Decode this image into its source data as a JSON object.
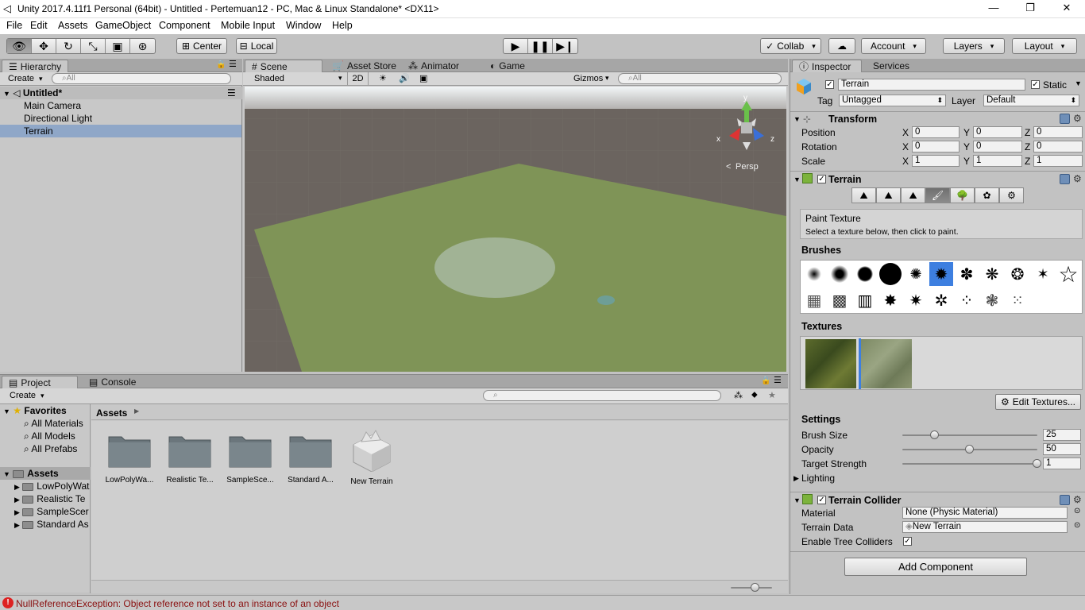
{
  "window": {
    "title": "Unity 2017.4.11f1 Personal (64bit) - Untitled - Pertemuan12 - PC, Mac & Linux Standalone* <DX11>",
    "minimize": "—",
    "maximize": "❐",
    "close": "✕"
  },
  "menu": [
    "File",
    "Edit",
    "Assets",
    "GameObject",
    "Component",
    "Mobile Input",
    "Window",
    "Help"
  ],
  "toolbar": {
    "pivot_center": "Center",
    "pivot_local": "Local",
    "collab": "Collab",
    "account": "Account",
    "layers": "Layers",
    "layout": "Layout"
  },
  "hierarchy": {
    "tab": "Hierarchy",
    "create": "Create",
    "search_placeholder": "All",
    "scene": "Untitled*",
    "items": [
      "Main Camera",
      "Directional Light",
      "Terrain"
    ],
    "selected": "Terrain"
  },
  "scene_view": {
    "tabs": [
      "Scene",
      "Asset Store",
      "Animator",
      "Game"
    ],
    "shading": "Shaded",
    "mode_2d": "2D",
    "gizmos": "Gizmos",
    "search_placeholder": "All",
    "gizmo_y": "y",
    "gizmo_x": "x",
    "gizmo_z": "z",
    "persp": "Persp",
    "colors": {
      "sky": "#e8eef0",
      "ground": "#6b645f",
      "terrain": "#7f9457"
    }
  },
  "project": {
    "tabs": [
      "Project",
      "Console"
    ],
    "create": "Create",
    "favorites_label": "Favorites",
    "favorites": [
      "All Materials",
      "All Models",
      "All Prefabs"
    ],
    "assets_label": "Assets",
    "asset_folders": [
      "LowPolyWat",
      "Realistic Te",
      "SampleScer",
      "Standard As"
    ],
    "breadcrumb": "Assets",
    "grid_items": [
      {
        "name": "LowPolyWa...",
        "kind": "folder"
      },
      {
        "name": "Realistic Te...",
        "kind": "folder"
      },
      {
        "name": "SampleSce...",
        "kind": "folder"
      },
      {
        "name": "Standard A...",
        "kind": "folder"
      },
      {
        "name": "New Terrain",
        "kind": "terrain"
      }
    ]
  },
  "status": {
    "error": "NullReferenceException: Object reference not set to an instance of an object"
  },
  "inspector": {
    "tabs": [
      "Inspector",
      "Services"
    ],
    "object_name": "Terrain",
    "static_label": "Static",
    "tag_label": "Tag",
    "tag_value": "Untagged",
    "layer_label": "Layer",
    "layer_value": "Default",
    "transform": {
      "title": "Transform",
      "rows": [
        {
          "label": "Position",
          "x": "0",
          "y": "0",
          "z": "0"
        },
        {
          "label": "Rotation",
          "x": "0",
          "y": "0",
          "z": "0"
        },
        {
          "label": "Scale",
          "x": "1",
          "y": "1",
          "z": "1"
        }
      ],
      "axis_x": "X",
      "axis_y": "Y",
      "axis_z": "Z"
    },
    "terrain": {
      "title": "Terrain",
      "tool_title": "Paint Texture",
      "tool_help": "Select a texture below, then click to paint.",
      "brushes_label": "Brushes",
      "textures_label": "Textures",
      "edit_textures": "Edit Textures...",
      "settings_label": "Settings",
      "settings": [
        {
          "label": "Brush Size",
          "value": "25",
          "fraction": 0.24
        },
        {
          "label": "Opacity",
          "value": "50",
          "fraction": 0.5
        },
        {
          "label": "Target Strength",
          "value": "1",
          "fraction": 1.0
        }
      ],
      "lighting": "Lighting"
    },
    "collider": {
      "title": "Terrain Collider",
      "material_label": "Material",
      "material_value": "None (Physic Material)",
      "data_label": "Terrain Data",
      "data_value": "New Terrain",
      "trees_label": "Enable Tree Colliders"
    },
    "add_component": "Add Component"
  }
}
